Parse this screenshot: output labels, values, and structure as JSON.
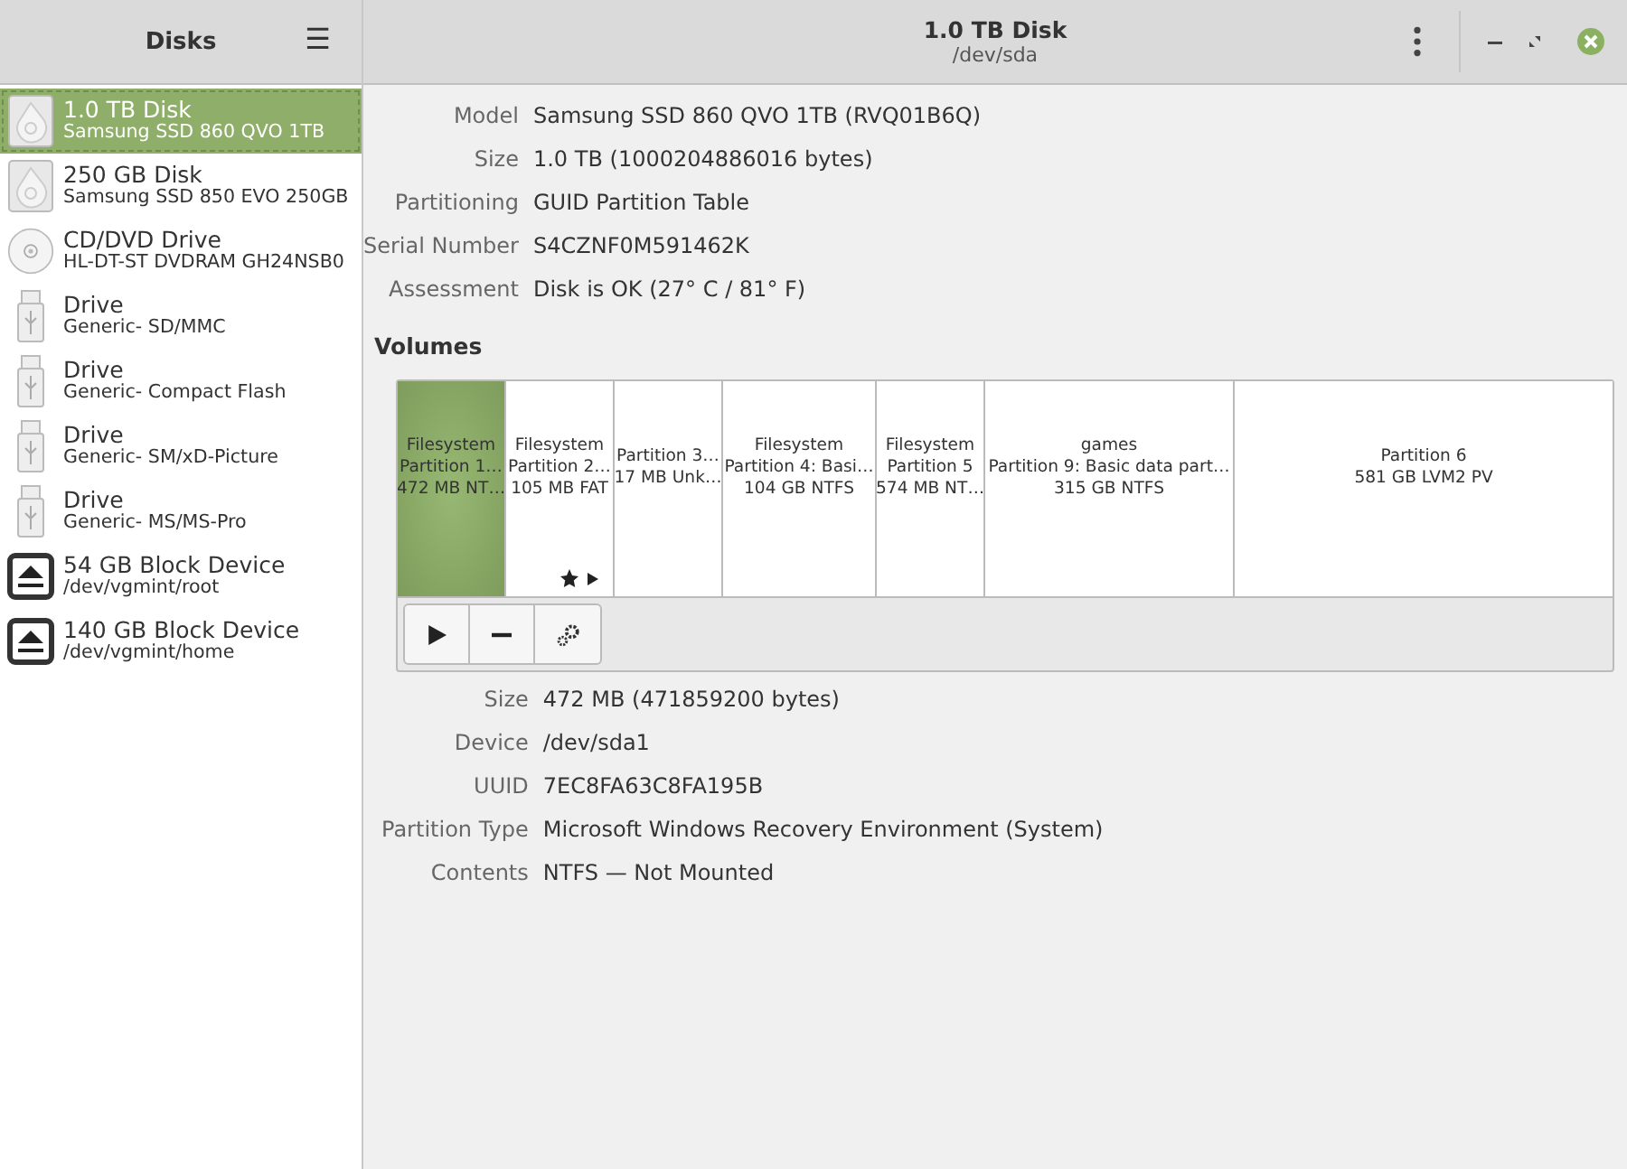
{
  "sidebar": {
    "title": "Disks",
    "menu_icon": "☰",
    "items": [
      {
        "kind": "disk",
        "title": "1.0 TB Disk",
        "subtitle": "Samsung SSD 860 QVO 1TB",
        "selected": true
      },
      {
        "kind": "disk",
        "title": "250 GB Disk",
        "subtitle": "Samsung SSD 850 EVO 250GB",
        "selected": false
      },
      {
        "kind": "optical",
        "title": "CD/DVD Drive",
        "subtitle": "HL-DT-ST DVDRAM GH24NSB0",
        "selected": false
      },
      {
        "kind": "usb",
        "title": "Drive",
        "subtitle": "Generic- SD/MMC",
        "selected": false
      },
      {
        "kind": "usb",
        "title": "Drive",
        "subtitle": "Generic- Compact Flash",
        "selected": false
      },
      {
        "kind": "usb",
        "title": "Drive",
        "subtitle": "Generic- SM/xD-Picture",
        "selected": false
      },
      {
        "kind": "usb",
        "title": "Drive",
        "subtitle": "Generic- MS/MS-Pro",
        "selected": false
      },
      {
        "kind": "block",
        "title": "54 GB Block Device",
        "subtitle": "/dev/vgmint/root",
        "selected": false
      },
      {
        "kind": "block",
        "title": "140 GB Block Device",
        "subtitle": "/dev/vgmint/home",
        "selected": false
      }
    ]
  },
  "header": {
    "title": "1.0 TB Disk",
    "subtitle": "/dev/sda"
  },
  "disk_info": [
    {
      "label": "Model",
      "value": "Samsung SSD 860 QVO 1TB (RVQ01B6Q)"
    },
    {
      "label": "Size",
      "value": "1.0 TB (1000204886016 bytes)"
    },
    {
      "label": "Partitioning",
      "value": "GUID Partition Table"
    },
    {
      "label": "Serial Number",
      "value": "S4CZNF0M591462K"
    },
    {
      "label": "Assessment",
      "value": "Disk is OK (27° C / 81° F)"
    }
  ],
  "volumes": {
    "heading": "Volumes",
    "segments": [
      {
        "lines": [
          "Filesystem",
          "Partition 1…",
          "472 MB NT…"
        ],
        "selected": true,
        "mounted_icons": false
      },
      {
        "lines": [
          "Filesystem",
          "Partition 2…",
          "105 MB FAT"
        ],
        "selected": false,
        "mounted_icons": true
      },
      {
        "lines": [
          "Partition 3…",
          "17 MB Unk…"
        ],
        "selected": false,
        "mounted_icons": false
      },
      {
        "lines": [
          "Filesystem",
          "Partition 4: Basi…",
          "104 GB NTFS"
        ],
        "selected": false,
        "mounted_icons": false
      },
      {
        "lines": [
          "Filesystem",
          "Partition 5",
          "574 MB NT…"
        ],
        "selected": false,
        "mounted_icons": false
      },
      {
        "lines": [
          "games",
          "Partition 9: Basic data part…",
          "315 GB NTFS"
        ],
        "selected": false,
        "mounted_icons": false
      },
      {
        "lines": [
          "Partition 6",
          "581 GB LVM2 PV"
        ],
        "selected": false,
        "mounted_icons": false
      }
    ]
  },
  "partition_info": [
    {
      "label": "Size",
      "value": "472 MB (471859200 bytes)"
    },
    {
      "label": "Device",
      "value": "/dev/sda1"
    },
    {
      "label": "UUID",
      "value": "7EC8FA63C8FA195B"
    },
    {
      "label": "Partition Type",
      "value": "Microsoft Windows Recovery Environment (System)"
    },
    {
      "label": "Contents",
      "value": "NTFS — Not Mounted"
    }
  ]
}
